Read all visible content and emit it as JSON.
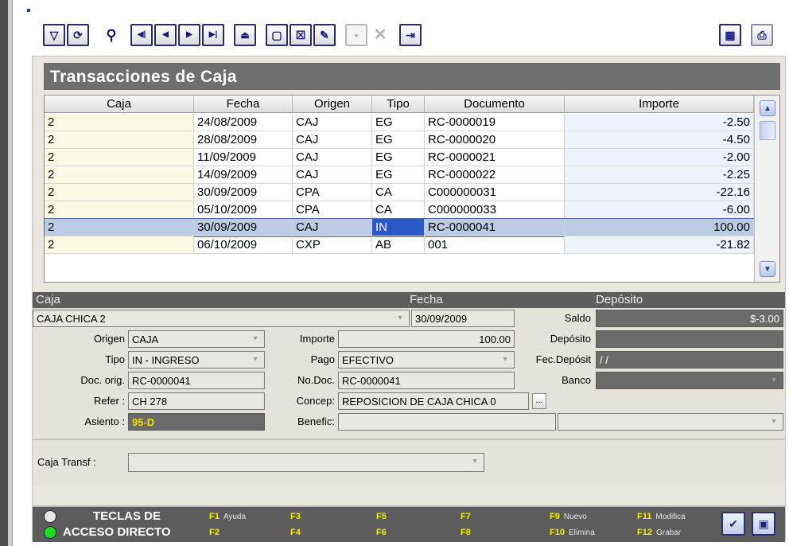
{
  "toolbar": {
    "icons": [
      "filter-icon",
      "refresh-icon",
      "binoculars-icon",
      "first-icon",
      "prev-icon",
      "next-icon",
      "last-icon",
      "eject-icon",
      "new-icon",
      "delete-doc-icon",
      "edit-icon",
      "save-icon",
      "cancel-icon",
      "exit-icon",
      "calculator-icon",
      "print-icon"
    ]
  },
  "title": "Transacciones de Caja",
  "grid": {
    "columns": [
      "Caja",
      "Fecha",
      "Origen",
      "Tipo",
      "Documento",
      "Importe"
    ],
    "rows": [
      [
        "2",
        "24/08/2009",
        "CAJ",
        "EG",
        "RC-0000019",
        "-2.50"
      ],
      [
        "2",
        "28/08/2009",
        "CAJ",
        "EG",
        "RC-0000020",
        "-4.50"
      ],
      [
        "2",
        "11/09/2009",
        "CAJ",
        "EG",
        "RC-0000021",
        "-2.00"
      ],
      [
        "2",
        "14/09/2009",
        "CAJ",
        "EG",
        "RC-0000022",
        "-2.25"
      ],
      [
        "2",
        "30/09/2009",
        "CPA",
        "CA",
        "C000000031",
        "-22.16"
      ],
      [
        "2",
        "05/10/2009",
        "CPA",
        "CA",
        "C000000033",
        "-6.00"
      ],
      [
        "2",
        "30/09/2009",
        "CAJ",
        "IN",
        "RC-0000041",
        "100.00"
      ],
      [
        "2",
        "06/10/2009",
        "CXP",
        "AB",
        "001",
        "-21.82"
      ]
    ],
    "selected_row": 6
  },
  "detail": {
    "hdr_caja": "Caja",
    "hdr_fecha": "Fecha",
    "hdr_deposito": "Depósito",
    "caja_value": "CAJA CHICA 2",
    "fecha_value": "30/09/2009",
    "saldo_label": "Saldo",
    "saldo_value": "$-3.00",
    "origen_label": "Origen",
    "origen_value": "CAJA",
    "importe_label": "Importe",
    "importe_value": "100.00",
    "deposito_label": "Depósito",
    "deposito_value": "",
    "tipo_label": "Tipo",
    "tipo_value": "IN - INGRESO",
    "pago_label": "Pago",
    "pago_value": "EFECTIVO",
    "fecdeposit_label": "Fec.Depósit",
    "fecdeposit_value": "/ /",
    "docorig_label": "Doc. orig.",
    "docorig_value": "RC-0000041",
    "nodoc_label": "No.Doc.",
    "nodoc_value": "RC-0000041",
    "banco_label": "Banco",
    "banco_value": "",
    "refer_label": "Refer :",
    "refer_value": "CH 278",
    "concep_label": "Concep:",
    "concep_value": "REPOSICION DE CAJA CHICA 0",
    "ellipsis": "...",
    "asiento_label": "Asiento :",
    "asiento_value": "95-D",
    "benefic_label": "Benefic:",
    "benefic_value": "",
    "benefic2_value": "",
    "cajatransf_label": "Caja Transf :",
    "cajatransf_value": ""
  },
  "footer": {
    "line1": "TECLAS DE",
    "line2": "ACCESO DIRECTO",
    "keys": [
      {
        "key": "F1",
        "desc": "Ayuda"
      },
      {
        "key": "F2",
        "desc": ""
      },
      {
        "key": "F3",
        "desc": ""
      },
      {
        "key": "F4",
        "desc": ""
      },
      {
        "key": "F5",
        "desc": ""
      },
      {
        "key": "F6",
        "desc": ""
      },
      {
        "key": "F7",
        "desc": ""
      },
      {
        "key": "F8",
        "desc": ""
      },
      {
        "key": "F9",
        "desc": "Nuevo"
      },
      {
        "key": "F10",
        "desc": "Elimina"
      },
      {
        "key": "F11",
        "desc": "Modifica"
      },
      {
        "key": "F12",
        "desc": "Grabar"
      }
    ]
  },
  "colors": {
    "accent_yellow": "#f0f000",
    "asiento_text": "#f4e000",
    "selected_row": "#bccce6",
    "led_green": "#1edc1e"
  }
}
